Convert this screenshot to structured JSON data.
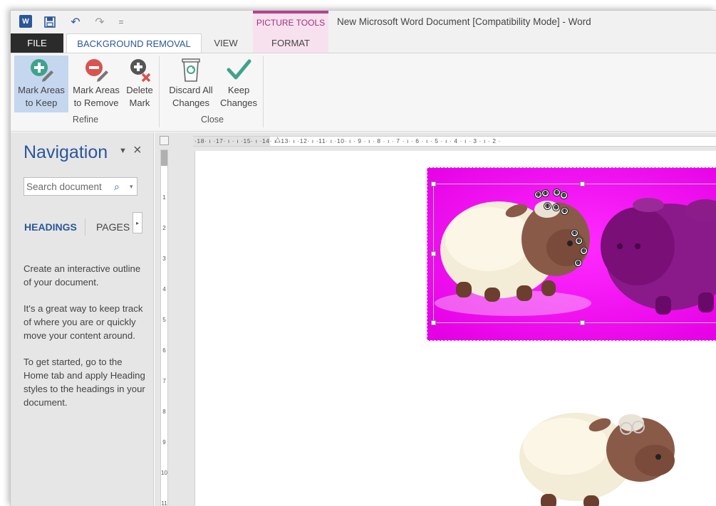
{
  "window": {
    "title": "New Microsoft Word Document [Compatibility Mode] - Word",
    "contextual_group": "PICTURE TOOLS",
    "word_logo": "W"
  },
  "quick_access": {
    "save_icon": "save-icon",
    "undo_icon": "undo-icon",
    "redo_icon": "redo-icon",
    "undo_glyph": "↶",
    "redo_glyph": "↷",
    "customize_glyph": "="
  },
  "tabs": [
    {
      "label": "FILE"
    },
    {
      "label": "BACKGROUND REMOVAL"
    },
    {
      "label": "VIEW"
    },
    {
      "label": "FORMAT"
    }
  ],
  "ribbon": {
    "groups": [
      {
        "label": "Refine",
        "buttons": [
          {
            "line1": "Mark Areas",
            "line2": "to Keep",
            "icon": "plus-pencil-icon"
          },
          {
            "line1": "Mark Areas",
            "line2": "to Remove",
            "icon": "minus-pencil-icon"
          },
          {
            "line1": "Delete",
            "line2": "Mark",
            "icon": "delete-mark-icon"
          }
        ]
      },
      {
        "label": "Close",
        "buttons": [
          {
            "line1": "Discard All",
            "line2": "Changes",
            "icon": "recycle-bin-icon"
          },
          {
            "line1": "Keep",
            "line2": "Changes",
            "icon": "checkmark-icon"
          }
        ]
      }
    ],
    "accent_keep": "#3fa38c",
    "accent_remove": "#d9534f"
  },
  "navigation": {
    "title": "Navigation",
    "menu_glyph": "▼",
    "close_glyph": "×",
    "search_placeholder": "Search document",
    "search_glyph": "⌕",
    "caret_glyph": "▾",
    "more_glyph": "▸",
    "tabs": [
      "HEADINGS",
      "PAGES"
    ],
    "help": [
      "Create an interactive outline of your document.",
      "It's a great way to keep track of where you are or quickly move your content around.",
      "To get started, go to the Home tab and apply Heading styles to the headings in your document."
    ]
  },
  "ruler": {
    "horizontal_text": "·18· ı ·17· ı ·  ı ·15· ı ·14· ı ·13· ı ·12· ı ·11· ı ·10· ı · 9 · ı · 8 · ı · 7 · ı · 6 · ı · 5 · ı · 4 · ı · 3 · ı · 2 ·",
    "vertical_numbers": [
      "1",
      "2",
      "3",
      "4",
      "5",
      "6",
      "7",
      "8",
      "9",
      "10",
      "11"
    ],
    "indent_glyph": "△"
  },
  "document": {
    "removal_color": "#ff00ff",
    "mark_glyph": "⊕"
  }
}
